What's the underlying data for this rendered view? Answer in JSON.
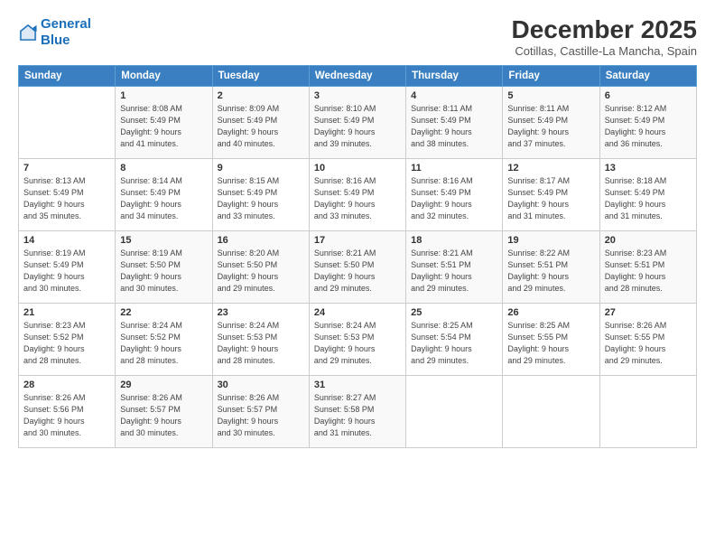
{
  "logo": {
    "line1": "General",
    "line2": "Blue"
  },
  "title": "December 2025",
  "subtitle": "Cotillas, Castille-La Mancha, Spain",
  "days_header": [
    "Sunday",
    "Monday",
    "Tuesday",
    "Wednesday",
    "Thursday",
    "Friday",
    "Saturday"
  ],
  "weeks": [
    [
      {
        "day": "",
        "info": ""
      },
      {
        "day": "1",
        "info": "Sunrise: 8:08 AM\nSunset: 5:49 PM\nDaylight: 9 hours\nand 41 minutes."
      },
      {
        "day": "2",
        "info": "Sunrise: 8:09 AM\nSunset: 5:49 PM\nDaylight: 9 hours\nand 40 minutes."
      },
      {
        "day": "3",
        "info": "Sunrise: 8:10 AM\nSunset: 5:49 PM\nDaylight: 9 hours\nand 39 minutes."
      },
      {
        "day": "4",
        "info": "Sunrise: 8:11 AM\nSunset: 5:49 PM\nDaylight: 9 hours\nand 38 minutes."
      },
      {
        "day": "5",
        "info": "Sunrise: 8:11 AM\nSunset: 5:49 PM\nDaylight: 9 hours\nand 37 minutes."
      },
      {
        "day": "6",
        "info": "Sunrise: 8:12 AM\nSunset: 5:49 PM\nDaylight: 9 hours\nand 36 minutes."
      }
    ],
    [
      {
        "day": "7",
        "info": "Sunrise: 8:13 AM\nSunset: 5:49 PM\nDaylight: 9 hours\nand 35 minutes."
      },
      {
        "day": "8",
        "info": "Sunrise: 8:14 AM\nSunset: 5:49 PM\nDaylight: 9 hours\nand 34 minutes."
      },
      {
        "day": "9",
        "info": "Sunrise: 8:15 AM\nSunset: 5:49 PM\nDaylight: 9 hours\nand 33 minutes."
      },
      {
        "day": "10",
        "info": "Sunrise: 8:16 AM\nSunset: 5:49 PM\nDaylight: 9 hours\nand 33 minutes."
      },
      {
        "day": "11",
        "info": "Sunrise: 8:16 AM\nSunset: 5:49 PM\nDaylight: 9 hours\nand 32 minutes."
      },
      {
        "day": "12",
        "info": "Sunrise: 8:17 AM\nSunset: 5:49 PM\nDaylight: 9 hours\nand 31 minutes."
      },
      {
        "day": "13",
        "info": "Sunrise: 8:18 AM\nSunset: 5:49 PM\nDaylight: 9 hours\nand 31 minutes."
      }
    ],
    [
      {
        "day": "14",
        "info": "Sunrise: 8:19 AM\nSunset: 5:49 PM\nDaylight: 9 hours\nand 30 minutes."
      },
      {
        "day": "15",
        "info": "Sunrise: 8:19 AM\nSunset: 5:50 PM\nDaylight: 9 hours\nand 30 minutes."
      },
      {
        "day": "16",
        "info": "Sunrise: 8:20 AM\nSunset: 5:50 PM\nDaylight: 9 hours\nand 29 minutes."
      },
      {
        "day": "17",
        "info": "Sunrise: 8:21 AM\nSunset: 5:50 PM\nDaylight: 9 hours\nand 29 minutes."
      },
      {
        "day": "18",
        "info": "Sunrise: 8:21 AM\nSunset: 5:51 PM\nDaylight: 9 hours\nand 29 minutes."
      },
      {
        "day": "19",
        "info": "Sunrise: 8:22 AM\nSunset: 5:51 PM\nDaylight: 9 hours\nand 29 minutes."
      },
      {
        "day": "20",
        "info": "Sunrise: 8:23 AM\nSunset: 5:51 PM\nDaylight: 9 hours\nand 28 minutes."
      }
    ],
    [
      {
        "day": "21",
        "info": "Sunrise: 8:23 AM\nSunset: 5:52 PM\nDaylight: 9 hours\nand 28 minutes."
      },
      {
        "day": "22",
        "info": "Sunrise: 8:24 AM\nSunset: 5:52 PM\nDaylight: 9 hours\nand 28 minutes."
      },
      {
        "day": "23",
        "info": "Sunrise: 8:24 AM\nSunset: 5:53 PM\nDaylight: 9 hours\nand 28 minutes."
      },
      {
        "day": "24",
        "info": "Sunrise: 8:24 AM\nSunset: 5:53 PM\nDaylight: 9 hours\nand 29 minutes."
      },
      {
        "day": "25",
        "info": "Sunrise: 8:25 AM\nSunset: 5:54 PM\nDaylight: 9 hours\nand 29 minutes."
      },
      {
        "day": "26",
        "info": "Sunrise: 8:25 AM\nSunset: 5:55 PM\nDaylight: 9 hours\nand 29 minutes."
      },
      {
        "day": "27",
        "info": "Sunrise: 8:26 AM\nSunset: 5:55 PM\nDaylight: 9 hours\nand 29 minutes."
      }
    ],
    [
      {
        "day": "28",
        "info": "Sunrise: 8:26 AM\nSunset: 5:56 PM\nDaylight: 9 hours\nand 30 minutes."
      },
      {
        "day": "29",
        "info": "Sunrise: 8:26 AM\nSunset: 5:57 PM\nDaylight: 9 hours\nand 30 minutes."
      },
      {
        "day": "30",
        "info": "Sunrise: 8:26 AM\nSunset: 5:57 PM\nDaylight: 9 hours\nand 30 minutes."
      },
      {
        "day": "31",
        "info": "Sunrise: 8:27 AM\nSunset: 5:58 PM\nDaylight: 9 hours\nand 31 minutes."
      },
      {
        "day": "",
        "info": ""
      },
      {
        "day": "",
        "info": ""
      },
      {
        "day": "",
        "info": ""
      }
    ]
  ]
}
